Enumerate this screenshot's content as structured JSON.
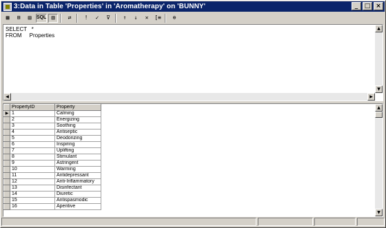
{
  "window": {
    "title": "3:Data in Table 'Properties' in 'Aromatherapy' on 'BUNNY'",
    "minimize": "_",
    "maximize": "□",
    "close": "×"
  },
  "toolbar": {
    "buttons": [
      {
        "name": "diagram-pane-icon",
        "glyph": "▦"
      },
      {
        "name": "grid-pane-icon",
        "glyph": "⊞"
      },
      {
        "name": "results-pane-icon",
        "glyph": "▤"
      },
      {
        "name": "sql-pane-button",
        "glyph": "SQL"
      },
      {
        "name": "show-results-icon",
        "glyph": "▥"
      },
      {
        "name": "change-query-type-icon",
        "glyph": "⇄"
      },
      {
        "name": "run-query-icon",
        "glyph": "!"
      },
      {
        "name": "verify-sql-icon",
        "glyph": "✓"
      },
      {
        "name": "filter-icon",
        "glyph": "⊽"
      },
      {
        "name": "sort-ascending-icon",
        "glyph": "↑"
      },
      {
        "name": "sort-descending-icon",
        "glyph": "↓"
      },
      {
        "name": "remove-filter-icon",
        "glyph": "✕"
      },
      {
        "name": "group-by-icon",
        "glyph": "[≡"
      },
      {
        "name": "add-table-icon",
        "glyph": "⊕"
      }
    ]
  },
  "sql": {
    "lines": [
      "SELECT   *",
      "FROM     Properties"
    ]
  },
  "grid": {
    "columns": [
      "PropertyID",
      "Property"
    ],
    "current_row_marker": "▶",
    "rows": [
      [
        "1",
        "Calming"
      ],
      [
        "2",
        "Energizing"
      ],
      [
        "3",
        "Soothing"
      ],
      [
        "4",
        "Antiseptic"
      ],
      [
        "5",
        "Deodorizing"
      ],
      [
        "6",
        "Inspiring"
      ],
      [
        "7",
        "Uplifting"
      ],
      [
        "8",
        "Stimulant"
      ],
      [
        "9",
        "Astringent"
      ],
      [
        "10",
        "Warming"
      ],
      [
        "11",
        "Antidepressant"
      ],
      [
        "12",
        "Anti-Inflammatory"
      ],
      [
        "13",
        "Disinfectant"
      ],
      [
        "14",
        "Diuretic"
      ],
      [
        "15",
        "Antispasmodic"
      ],
      [
        "16",
        "Aperitive"
      ]
    ]
  }
}
